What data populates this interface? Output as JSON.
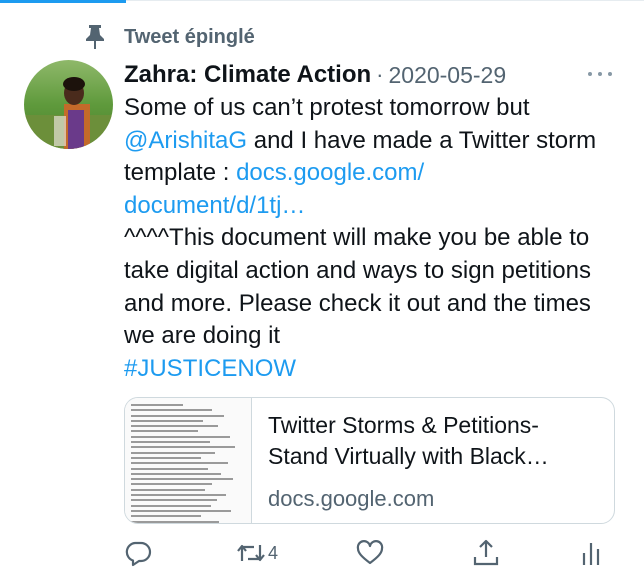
{
  "pinned": {
    "label": "Tweet épinglé",
    "icon": "pin-icon"
  },
  "tweet": {
    "author": "Zahra: Climate Action",
    "separator": "·",
    "date": "2020-05-29",
    "body": {
      "text1": "Some of us can’t protest tomorrow but ",
      "mention": "@ArishitaG",
      "text2": " and I have made a Twitter storm template : ",
      "link1": "docs.google.com/",
      "link2": "document/d/1tj…",
      "text3": "^^^^This document will make you be able to take digital action and ways to sign petitions and more. Please check it out and the times we are doing it",
      "hashtag": "#JUSTICENOW"
    },
    "card": {
      "title_line1": "Twitter Storms & Petitions-",
      "title_line2": "Stand Virtually with Black…",
      "domain": "docs.google.com"
    },
    "actions": {
      "reply_icon": "reply-icon",
      "retweet_icon": "retweet-icon",
      "retweet_count": "4",
      "like_icon": "heart-icon",
      "share_icon": "share-icon",
      "analytics_icon": "analytics-icon"
    }
  },
  "colors": {
    "accent": "#1d9bf0",
    "secondary_text": "#536471",
    "border": "#cfd9de"
  }
}
